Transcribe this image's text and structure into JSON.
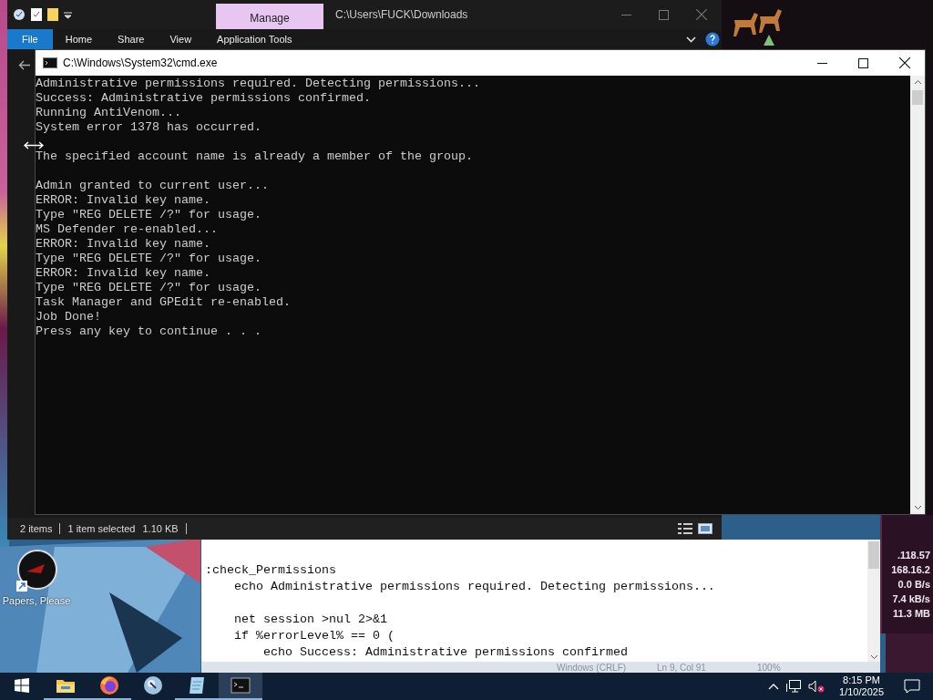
{
  "explorer": {
    "manage_tab": "Manage",
    "path": "C:\\Users\\FUCK\\Downloads",
    "ribbon_tabs": [
      {
        "label": "File",
        "selected": true
      },
      {
        "label": "Home",
        "selected": false
      },
      {
        "label": "Share",
        "selected": false
      },
      {
        "label": "View",
        "selected": false
      },
      {
        "label": "Application Tools",
        "selected": false
      }
    ],
    "status_bar": {
      "items": "2 items",
      "selection": "1 item selected",
      "size": "1.10 KB"
    }
  },
  "cmd": {
    "title": "C:\\Windows\\System32\\cmd.exe",
    "blocks": [
      [
        "Administrative permissions required. Detecting permissions...",
        "Success: Administrative permissions confirmed.",
        "Running AntiVenom...",
        "System error 1378 has occurred."
      ],
      [
        "The specified account name is already a member of the group."
      ],
      [
        "Admin granted to current user...",
        "ERROR: Invalid key name.",
        "Type \"REG DELETE /?\" for usage.",
        "MS Defender re-enabled...",
        "ERROR: Invalid key name.",
        "Type \"REG DELETE /?\" for usage.",
        "ERROR: Invalid key name.",
        "Type \"REG DELETE /?\" for usage.",
        "Task Manager and GPEdit re-enabled.",
        "Job Done!",
        "Press any key to continue . . ."
      ]
    ]
  },
  "notepad": {
    "blocks": [
      [
        ":check_Permissions",
        "    echo Administrative permissions required. Detecting permissions..."
      ],
      [
        "    net session >nul 2>&1",
        "    if %errorLevel% == 0 (",
        "        echo Success: Administrative permissions confirmed"
      ]
    ],
    "status_bar": [
      "Windows (CRLF)",
      "Ln 9, Col 91",
      "100%"
    ]
  },
  "network_meter": {
    "readings": [
      ".118.57",
      "168.16.2",
      "0.0 B/s",
      "7.4 kB/s",
      "11.3 MB"
    ]
  },
  "desktop": {
    "icons": [
      {
        "label": "Papers, Please"
      }
    ]
  },
  "taskbar": {
    "apps": [
      {
        "kind": "explorer",
        "running": true,
        "selected": false
      },
      {
        "kind": "firefox",
        "running": true,
        "selected": false
      },
      {
        "kind": "globe",
        "running": false,
        "selected": false
      },
      {
        "kind": "notepad",
        "running": true,
        "selected": false
      },
      {
        "kind": "terminal",
        "running": true,
        "selected": true
      }
    ],
    "time": "8:15 PM",
    "date": "1/10/2025"
  }
}
